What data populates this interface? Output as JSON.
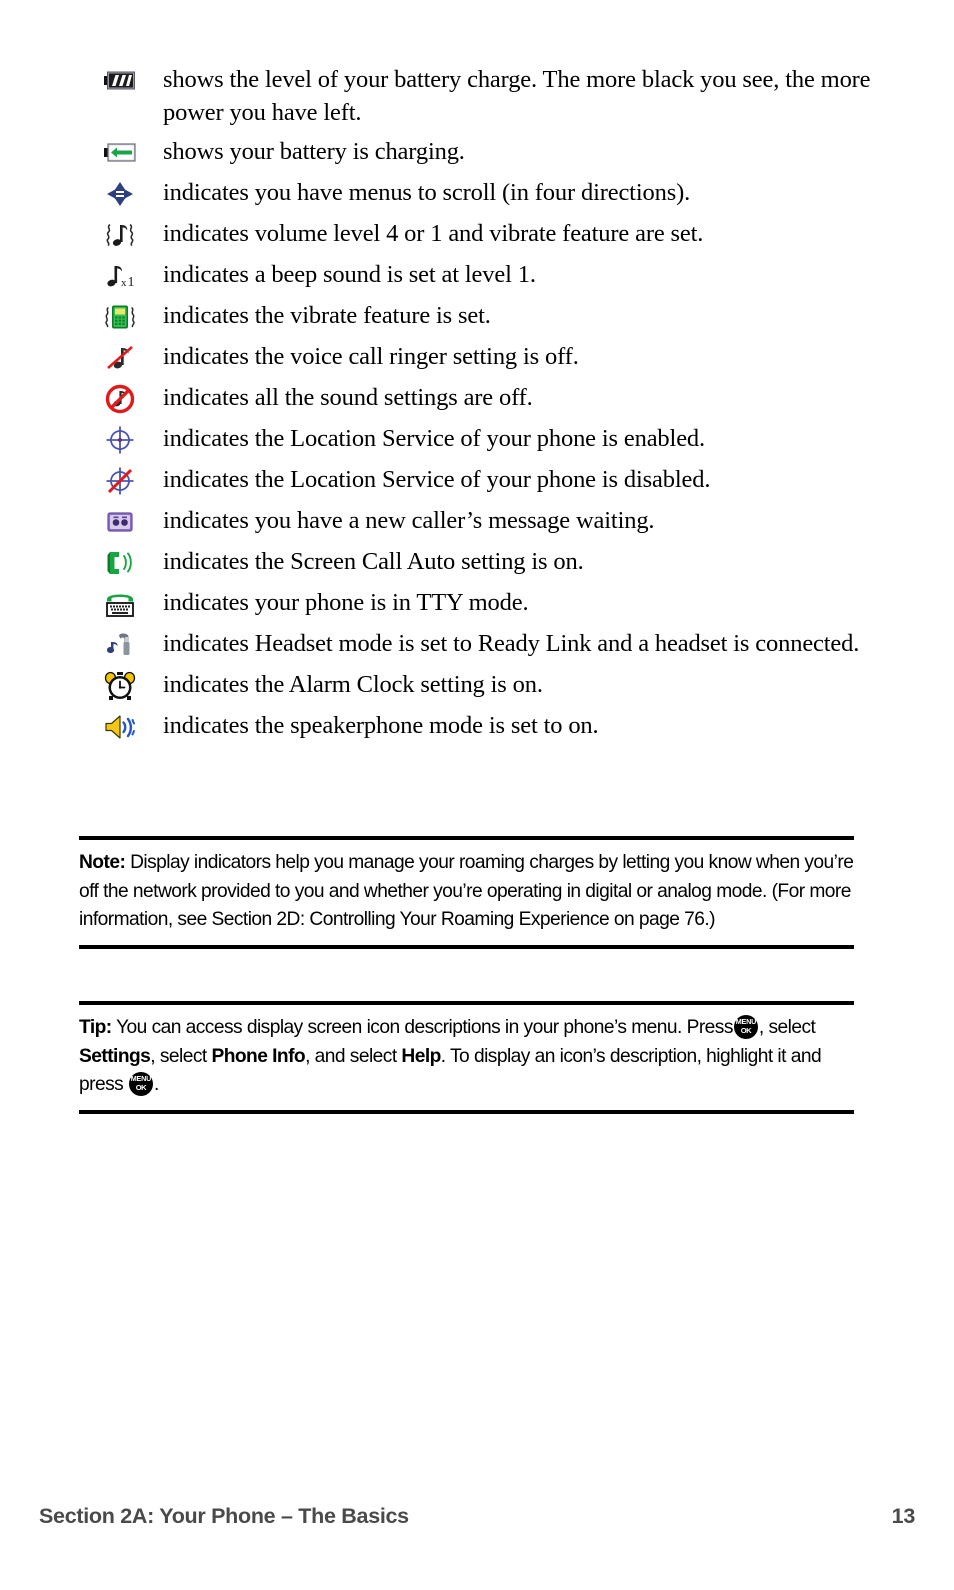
{
  "page": {
    "document_type": "phone user guide page",
    "footer_section": "Section 2A: Your Phone – The Basics",
    "footer_page_number": "13"
  },
  "icon_list": [
    {
      "icon": "battery-level-icon",
      "description": "shows the level of your battery charge. The more black you see, the more power you have left."
    },
    {
      "icon": "battery-charging-icon",
      "description": "shows your battery is charging."
    },
    {
      "icon": "four-direction-scroll-icon",
      "description": "indicates you have menus to scroll (in four directions)."
    },
    {
      "icon": "note-vibrate-icon",
      "description": "indicates volume level 4 or 1 and vibrate feature are set."
    },
    {
      "icon": "beep-level-one-icon",
      "description": "indicates a beep sound is set at level 1."
    },
    {
      "icon": "vibrate-phone-icon",
      "description": "indicates the vibrate feature is set."
    },
    {
      "icon": "ringer-off-icon",
      "description": "indicates the voice call ringer setting is off."
    },
    {
      "icon": "all-sounds-off-icon",
      "description": "indicates all the sound settings are off."
    },
    {
      "icon": "location-service-enabled-icon",
      "description": "indicates the Location Service of your phone is enabled."
    },
    {
      "icon": "location-service-disabled-icon",
      "description": "indicates the Location Service of your phone is disabled."
    },
    {
      "icon": "caller-message-waiting-icon",
      "description": "indicates you have a new caller’s message waiting."
    },
    {
      "icon": "screen-call-auto-icon",
      "description": "indicates the Screen Call Auto setting is on."
    },
    {
      "icon": "tty-mode-icon",
      "description": "indicates your phone is in TTY mode."
    },
    {
      "icon": "headset-ready-link-icon",
      "description": "indicates Headset mode is set to Ready Link and a headset is connected."
    },
    {
      "icon": "alarm-clock-icon",
      "description": "indicates the Alarm Clock setting is on."
    },
    {
      "icon": "speakerphone-on-icon",
      "description": "indicates the speakerphone mode is set to on."
    }
  ],
  "note": {
    "label": "Note:",
    "text_1": "Display indicators help you manage your roaming charges by letting you know when you’re off the network provided to you and whether you’re operating in digital or analog mode. (For more information, see Section 2D: Controlling Your Roaming Experience on page 76.)"
  },
  "tip": {
    "label": "Tip:",
    "text_1": "You can access display screen icon descriptions in your phone’s menu. Press",
    "text_2": ", select",
    "bold_1": "Settings",
    "text_3": ", select",
    "bold_2": "Phone Info",
    "text_4": ", and select",
    "bold_3": "Help",
    "text_5": ". To display an icon’s description, highlight it and press",
    "text_6": ".",
    "menu_key_top": "MENU",
    "menu_key_bottom": "OK"
  },
  "colors": {
    "footer_text": "#4a4a4a",
    "battery_border": "#9a9aa8",
    "charge_green": "#1aa544",
    "scroll_blue": "#2e3f7f",
    "vibrate_green": "#18a03a",
    "slash_red": "#e01b1b",
    "location_blue": "#4a54b4",
    "message_purple": "#8a6fbf",
    "alarm_yellow": "#f2c400",
    "speaker_yellow": "#f5c518",
    "speaker_wave_blue": "#2255cc"
  }
}
